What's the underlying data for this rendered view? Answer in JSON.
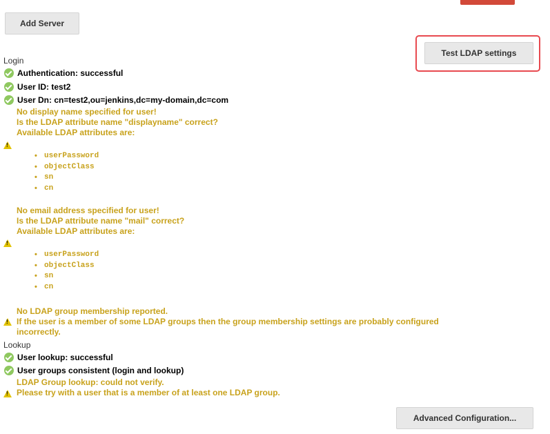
{
  "buttons": {
    "add_server": "Add Server",
    "test_ldap": "Test LDAP settings",
    "advanced": "Advanced Configuration..."
  },
  "login": {
    "title": "Login",
    "auth": "Authentication: successful",
    "user_id": "User ID: test2",
    "user_dn": "User Dn: cn=test2,ou=jenkins,dc=my-domain,dc=com",
    "display_name_warning": [
      "No display name specified for user!",
      "Is the LDAP attribute name \"displayname\" correct?",
      "Available LDAP attributes are:"
    ],
    "display_name_attrs": [
      "userPassword",
      "objectClass",
      "sn",
      "cn"
    ],
    "email_warning": [
      "No email address specified for user!",
      "Is the LDAP attribute name \"mail\" correct?",
      "Available LDAP attributes are:"
    ],
    "email_attrs": [
      "userPassword",
      "objectClass",
      "sn",
      "cn"
    ],
    "group_warning": [
      "No LDAP group membership reported.",
      "If the user is a member of some LDAP groups then the group membership settings are probably configured",
      "incorrectly."
    ]
  },
  "lookup": {
    "title": "Lookup",
    "user_lookup": "User lookup: successful",
    "groups_consistent": "User groups consistent (login and lookup)",
    "group_lookup_warning": [
      "LDAP Group lookup: could not verify.",
      "Please try with a user that is a member of at least one LDAP group."
    ]
  },
  "icons": {
    "success": "check-circle-icon",
    "warning": "warning-triangle-icon"
  },
  "colors": {
    "success": "#8fc860",
    "warning_text": "#c8a21c",
    "warning_icon": "#e2c300",
    "highlight": "#e8494f",
    "button_bg": "#e8e8e8"
  }
}
